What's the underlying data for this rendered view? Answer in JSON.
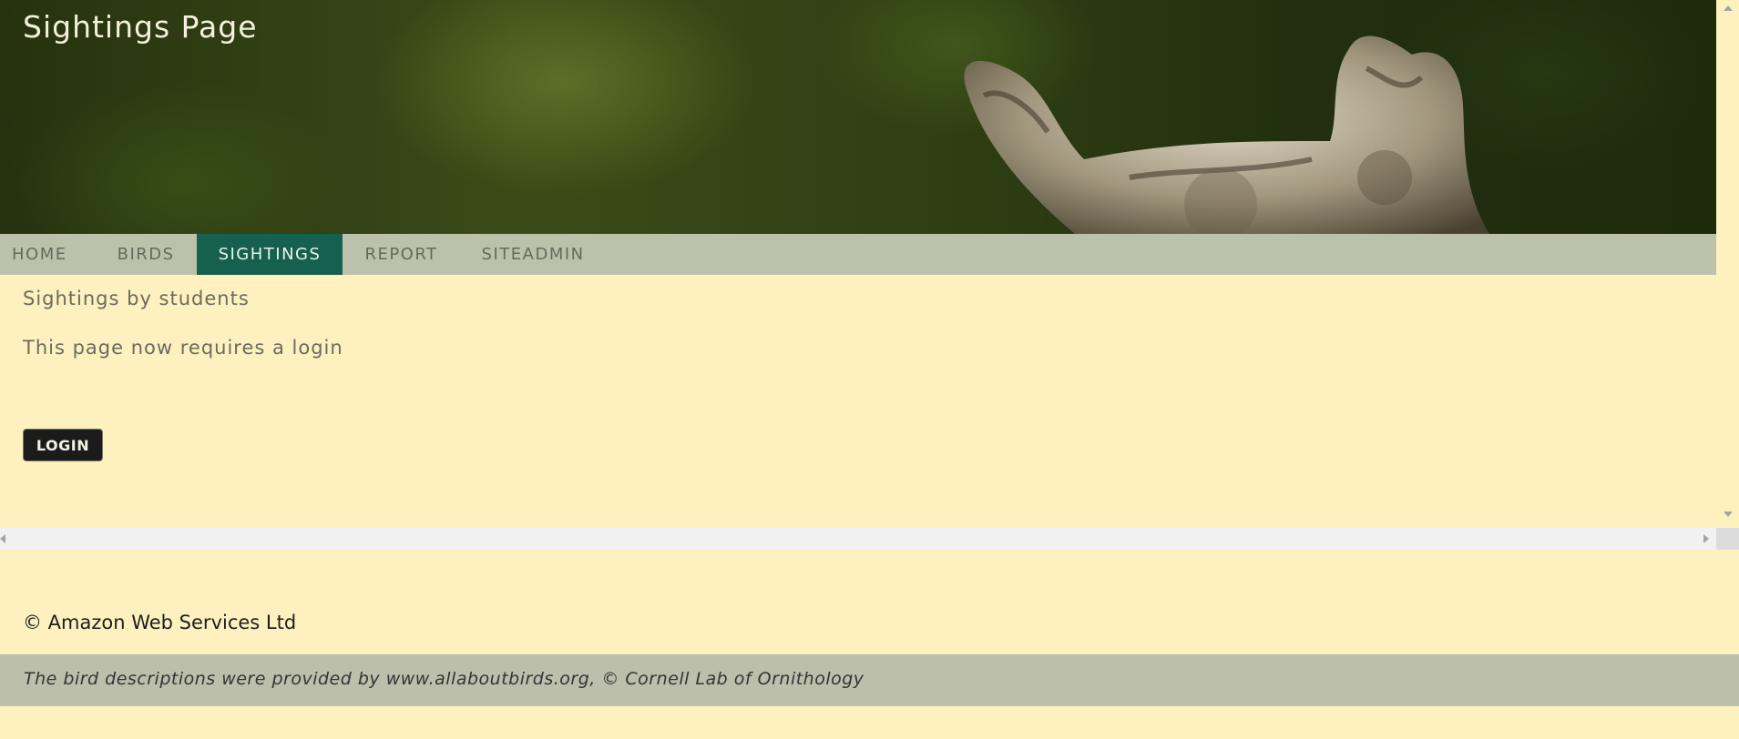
{
  "header": {
    "title": "Sightings Page"
  },
  "nav": {
    "items": [
      {
        "label": "HOME",
        "active": false
      },
      {
        "label": "BIRDS",
        "active": false
      },
      {
        "label": "SIGHTINGS",
        "active": true
      },
      {
        "label": "REPORT",
        "active": false
      },
      {
        "label": "SITEADMIN",
        "active": false
      }
    ]
  },
  "main": {
    "heading": "Sightings by students",
    "message": "This page now requires a login",
    "login_label": "LOGIN"
  },
  "footer": {
    "copyright": "© Amazon Web Services Ltd",
    "attribution": "The bird descriptions were provided by www.allaboutbirds.org, © Cornell Lab of Ornithology"
  },
  "colors": {
    "page_background": "#fef1bf",
    "nav_background": "#bcc1ac",
    "nav_active": "#16604f",
    "footer_bar": "#bcbfab",
    "login_button": "#1b1b1b"
  }
}
